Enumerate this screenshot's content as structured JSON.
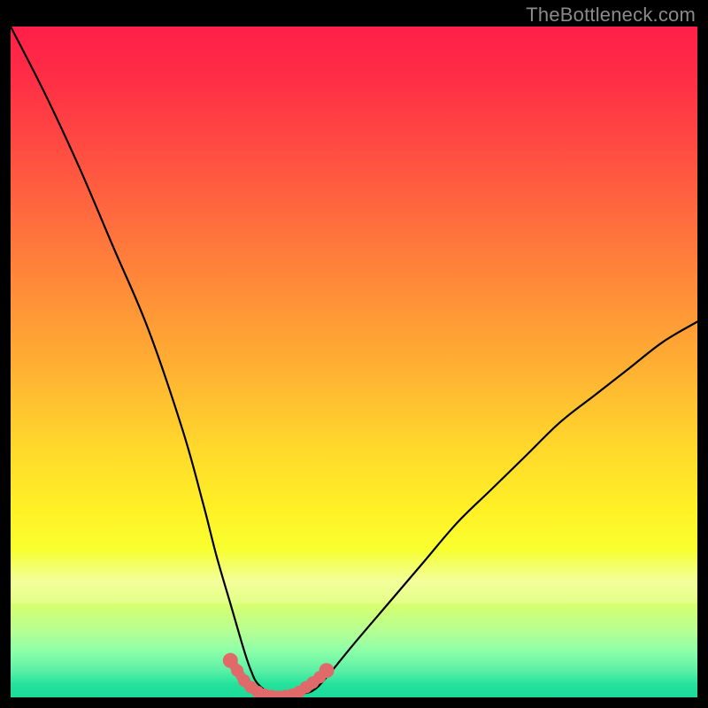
{
  "watermark": "TheBottleneck.com",
  "chart_data": {
    "type": "line",
    "title": "",
    "xlabel": "",
    "ylabel": "",
    "xlim": [
      0,
      100
    ],
    "ylim": [
      0,
      100
    ],
    "grid": false,
    "legend": false,
    "series": [
      {
        "name": "curve",
        "color": "#000000",
        "x": [
          0,
          5,
          10,
          15,
          20,
          25,
          28,
          30,
          32,
          34,
          35,
          36,
          38,
          40,
          42,
          44,
          46,
          50,
          55,
          60,
          65,
          70,
          75,
          80,
          85,
          90,
          95,
          100
        ],
        "values": [
          100,
          90,
          79,
          67,
          55,
          40,
          29,
          21,
          14,
          7,
          4,
          2,
          0.5,
          0,
          0.5,
          1,
          3,
          8,
          14,
          20,
          26,
          31,
          36,
          41,
          45,
          49,
          53,
          56
        ]
      },
      {
        "name": "bottom-marker",
        "color": "#e06a6a",
        "style": "beaded",
        "x": [
          32,
          33,
          34,
          35,
          36,
          37,
          38,
          39,
          40,
          41,
          42,
          43,
          44,
          45,
          46
        ],
        "values": [
          5.5,
          4,
          2.5,
          1.5,
          0.8,
          0.4,
          0.2,
          0.1,
          0.2,
          0.4,
          0.8,
          1.5,
          2.2,
          3,
          4
        ]
      }
    ],
    "background_gradient": {
      "orientation": "vertical",
      "stops": [
        {
          "pos": 0.0,
          "color": "#ff1f49"
        },
        {
          "pos": 0.28,
          "color": "#ff6a3e"
        },
        {
          "pos": 0.62,
          "color": "#ffd62c"
        },
        {
          "pos": 0.82,
          "color": "#eaff4a"
        },
        {
          "pos": 1.0,
          "color": "#1bd998"
        }
      ]
    }
  },
  "colors": {
    "frame": "#000000",
    "curve": "#000000",
    "marker": "#e06a6a",
    "watermark": "#8a8a8a"
  }
}
